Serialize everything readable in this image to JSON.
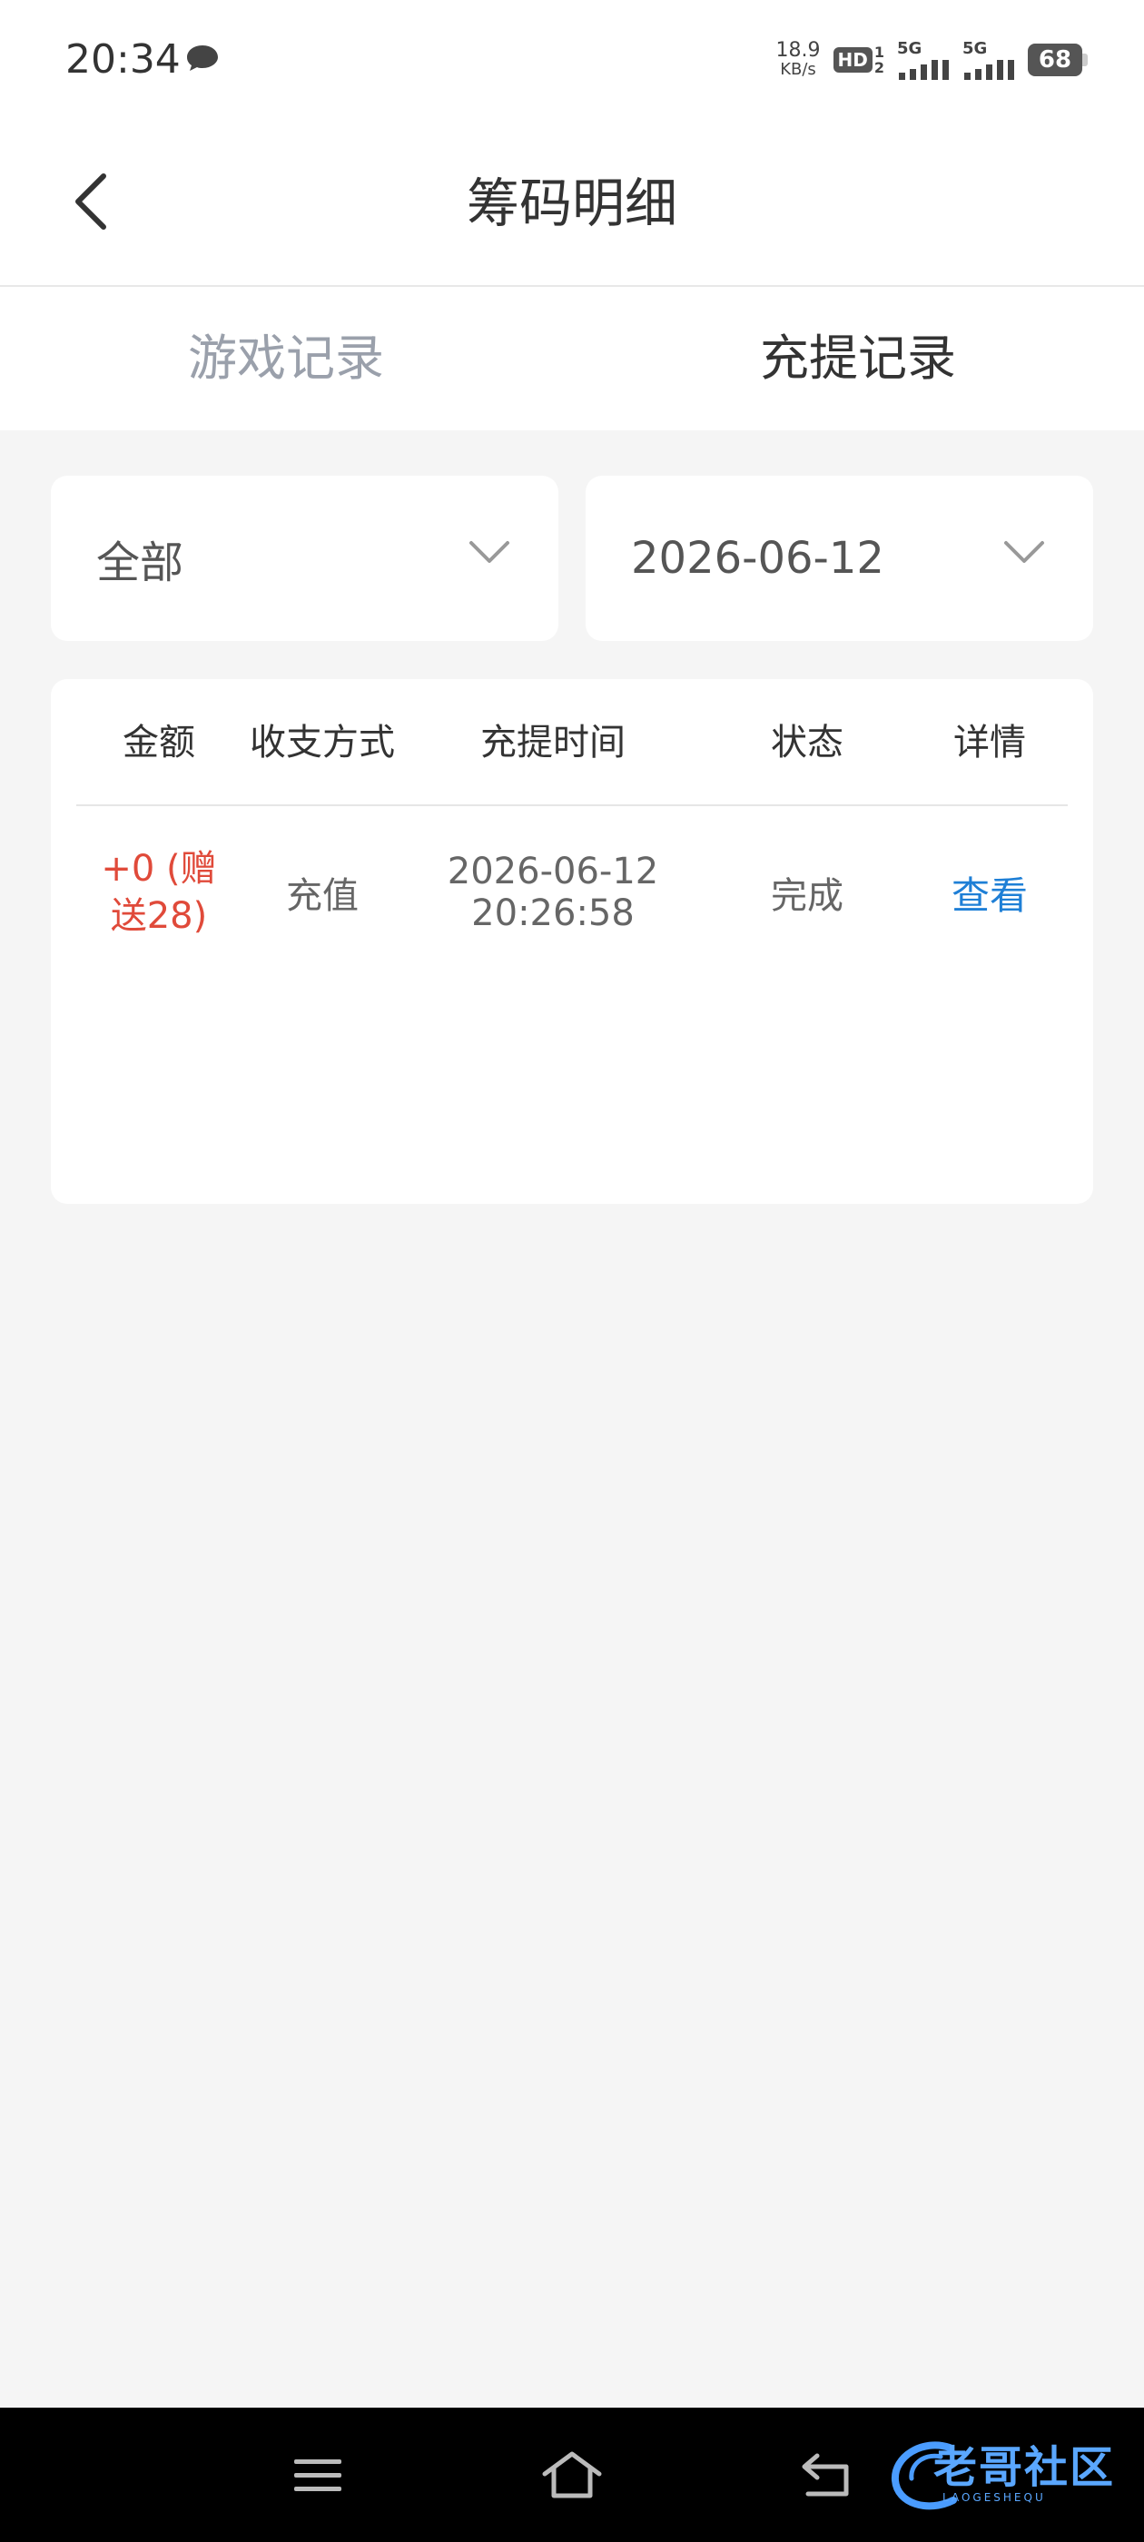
{
  "status_bar": {
    "time": "20:34",
    "net_speed_value": "18.9",
    "net_speed_unit": "KB/s",
    "hd_label": "HD",
    "hd_sub_top": "1",
    "hd_sub_bottom": "2",
    "signal1_label": "5G",
    "signal2_label": "5G",
    "battery_level": "68"
  },
  "header": {
    "title": "筹码明细"
  },
  "tabs": [
    {
      "label": "游戏记录",
      "active": false
    },
    {
      "label": "充提记录",
      "active": true
    }
  ],
  "filters": {
    "type_selected": "全部",
    "date_selected": "2026-06-12"
  },
  "table": {
    "columns": [
      "金额",
      "收支方式",
      "充提时间",
      "状态",
      "详情"
    ],
    "rows": [
      {
        "amount_line1": "+0 (赠",
        "amount_line2": "送28)",
        "method": "充值",
        "date": "2026-06-12",
        "time": "20:26:58",
        "status": "完成",
        "detail_link": "查看"
      }
    ]
  },
  "nav_bar": {
    "watermark_text": "老哥社区",
    "watermark_sub": "LAOGESHEQU"
  },
  "colors": {
    "amount": "#e04a3a",
    "link": "#1e7fd6",
    "inactive_tab": "#9aa0ab",
    "background": "#f5f5f5"
  }
}
